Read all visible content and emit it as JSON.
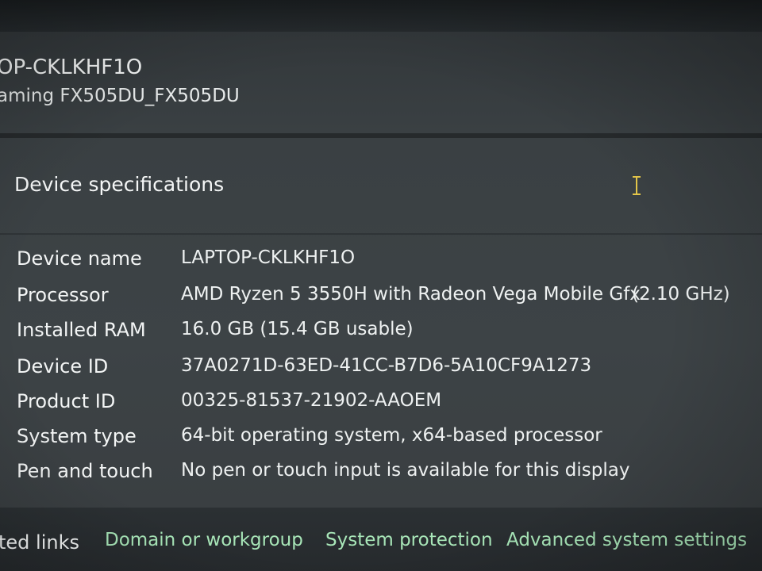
{
  "pc_card": {
    "name": "OP-CKLKHF1O",
    "model": "aming FX505DU_FX505DU"
  },
  "specs": {
    "title": "Device specifications",
    "rows": [
      {
        "label": "Device name",
        "value": "LAPTOP-CKLKHF1O"
      },
      {
        "label": "Processor",
        "value": "AMD Ryzen 5 3550H with Radeon Vega Mobile Gfx",
        "extra": "(2.10 GHz)"
      },
      {
        "label": "Installed RAM",
        "value": "16.0 GB (15.4 GB usable)"
      },
      {
        "label": "Device ID",
        "value": "37A0271D-63ED-41CC-B7D6-5A10CF9A1273"
      },
      {
        "label": "Product ID",
        "value": "00325-81537-21902-AAOEM"
      },
      {
        "label": "System type",
        "value": "64-bit operating system, x64-based processor"
      },
      {
        "label": "Pen and touch",
        "value": "No pen or touch input is available for this display"
      }
    ]
  },
  "related": {
    "label": "ted links",
    "links": [
      {
        "text": "Domain or workgroup"
      },
      {
        "text": "System protection"
      },
      {
        "text": "Advanced system settings"
      }
    ]
  },
  "colors": {
    "link": "#a8e6b8",
    "cursor": "#e6c84a",
    "card": "#3b4144"
  },
  "icons": {
    "cursor": "text-cursor-icon"
  }
}
